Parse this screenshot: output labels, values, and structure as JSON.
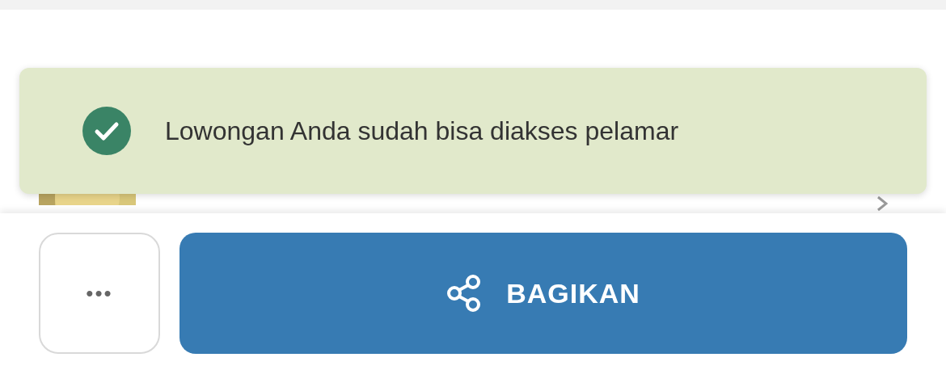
{
  "toast": {
    "message": "Lowongan Anda sudah bisa diakses pelamar"
  },
  "actions": {
    "more_label": "•••",
    "share_label": "BAGIKAN"
  }
}
